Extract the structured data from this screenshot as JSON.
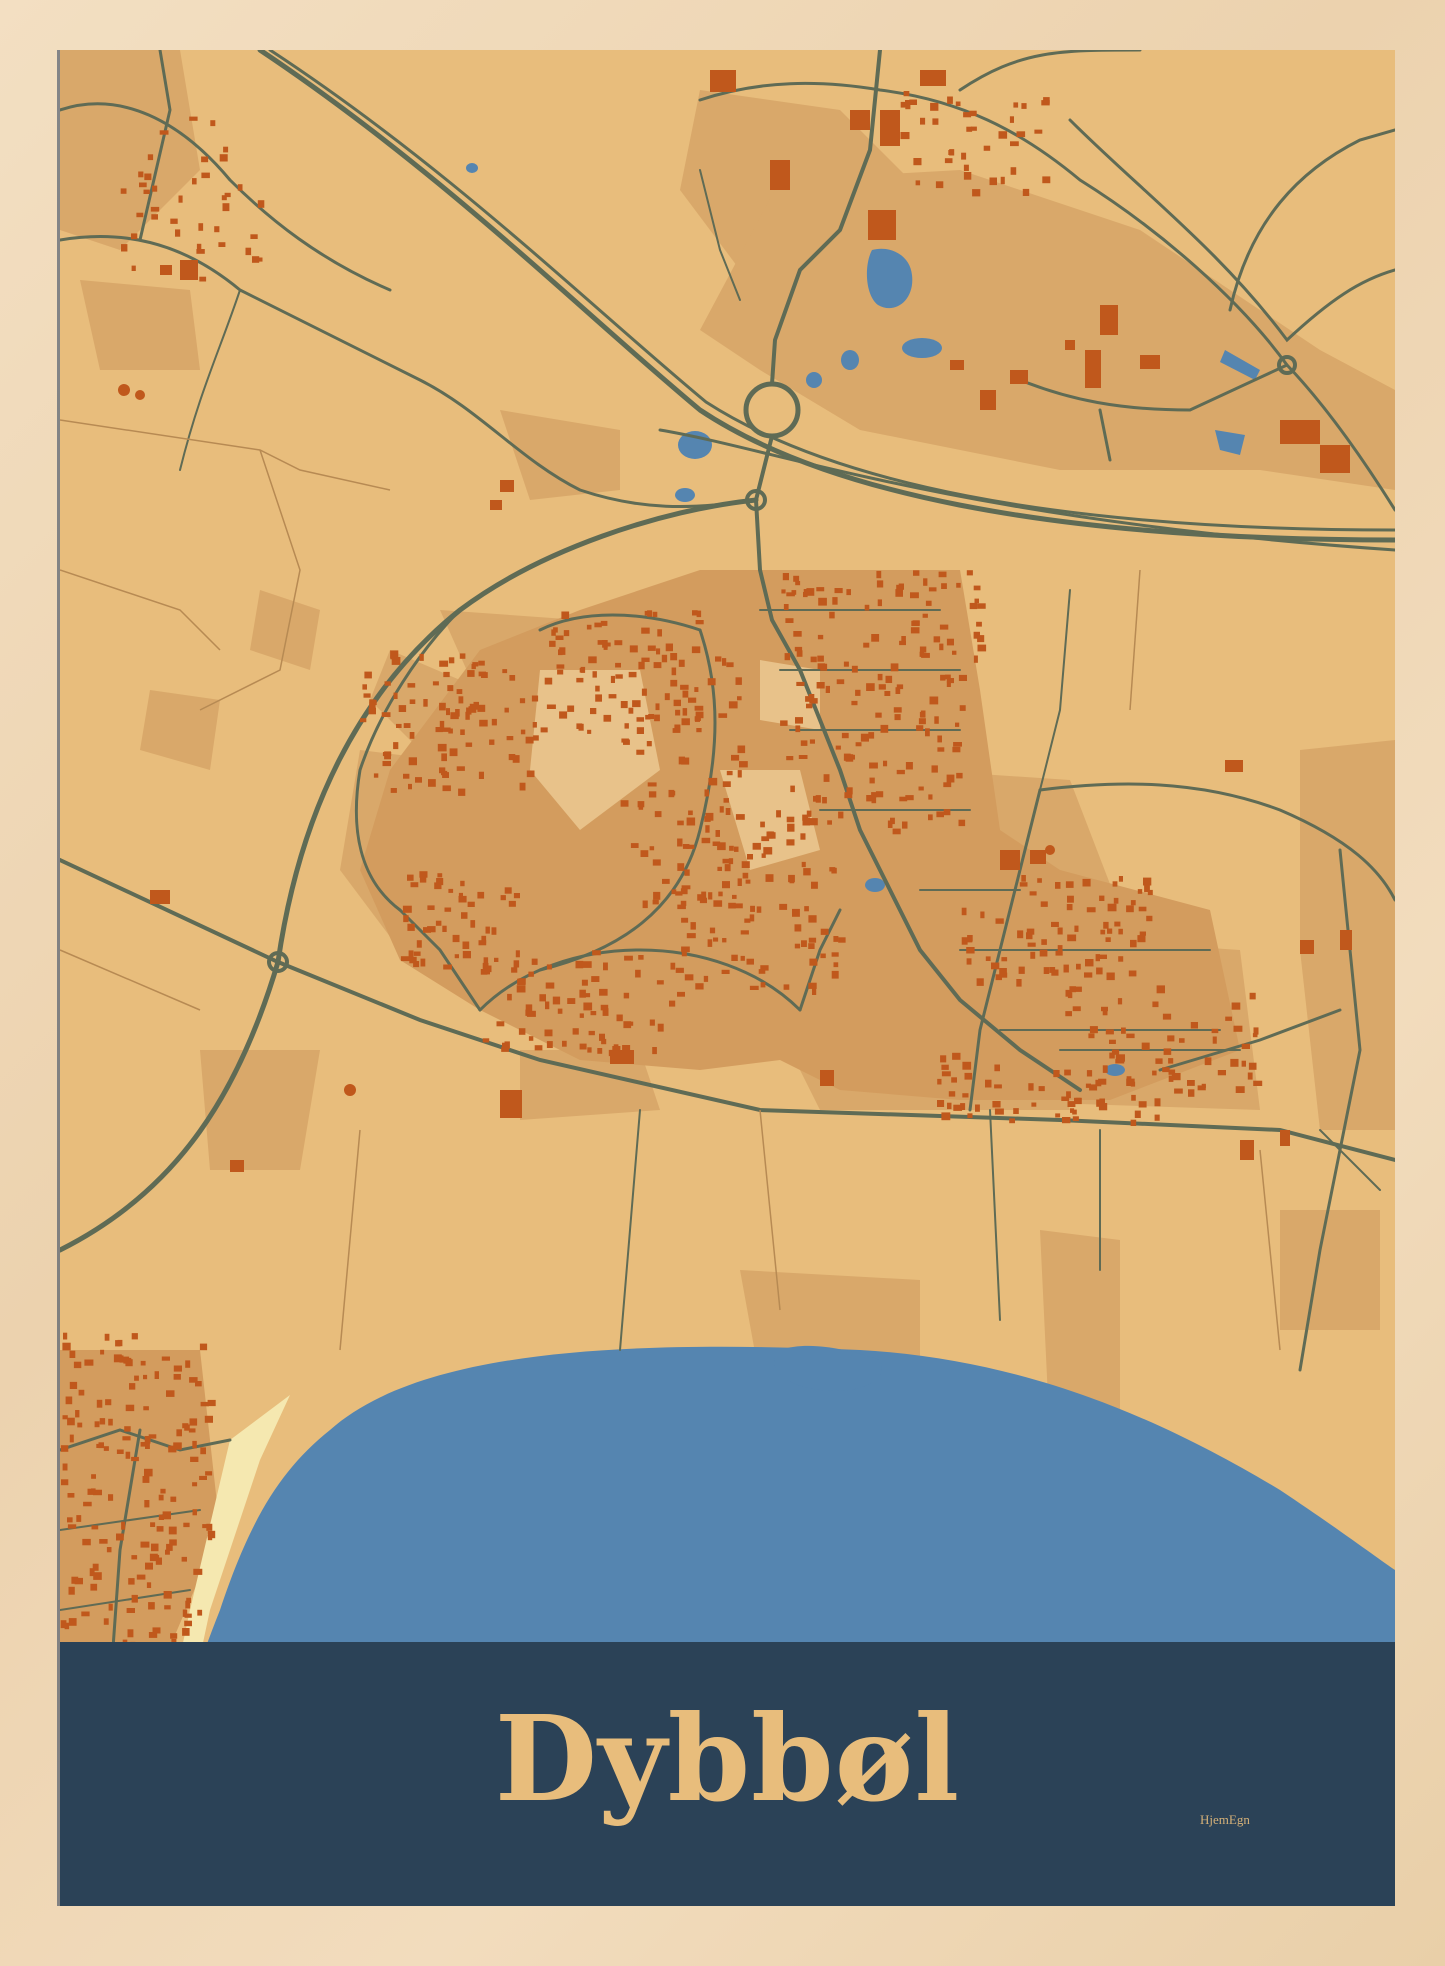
{
  "poster": {
    "title": "Dybbøl",
    "brand": "HjemEgn"
  },
  "colors": {
    "frame": "#ecd2ae",
    "land": "#e8bd7c",
    "fields": "#d9a86a",
    "buildings": "#c0581c",
    "roads": "#5f6b55",
    "water": "#5585b0",
    "beach": "#f5e8b0",
    "band": "#2b4257",
    "title_text": "#e8bd7c"
  },
  "icons": {
    "map": "map-illustration"
  }
}
